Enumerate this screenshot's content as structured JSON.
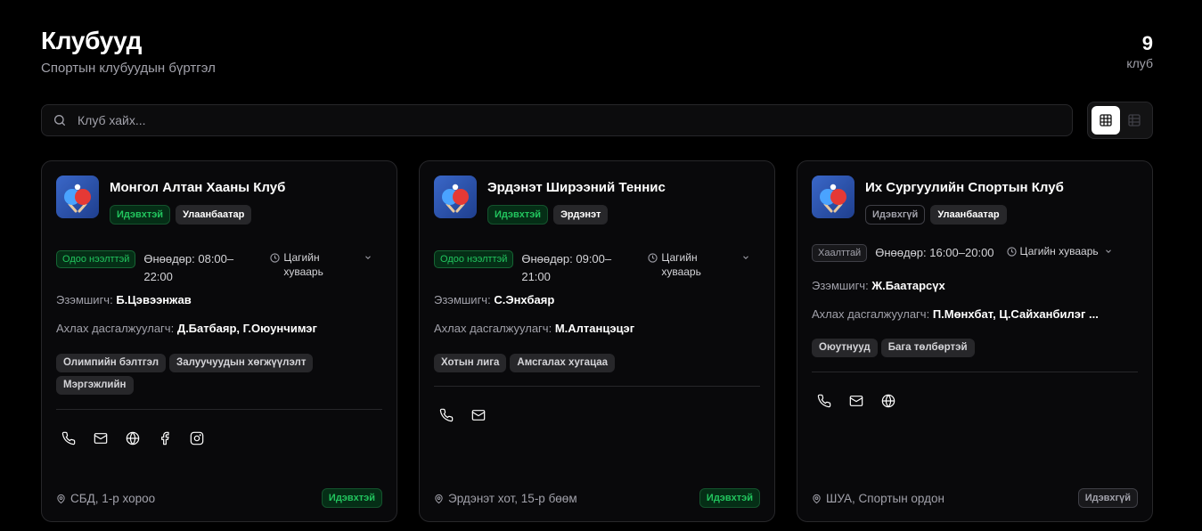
{
  "header": {
    "title": "Клубууд",
    "subtitle": "Спортын клубуудын бүртгэл",
    "count": "9",
    "count_label": "клуб"
  },
  "search": {
    "placeholder": "Клуб хайх...",
    "value": ""
  },
  "view_toggle": {
    "active": "grid"
  },
  "colors": {
    "accent_green": "#22c55e",
    "background": "#000000",
    "card": "#09090b",
    "border": "#27272a"
  },
  "clubs": [
    {
      "name": "Монгол Алтан Хааны Клуб",
      "status_badge": "Идэвхтэй",
      "location_badge": "Улаанбаатар",
      "hours_badge": "Одоо нээлттэй",
      "today": "Өнөөдөр: 08:00–22:00",
      "schedule_label": "Цагийн хуваарь",
      "owner_label": "Эзэмшигч:",
      "owner": "Б.Цэвээнжав",
      "coach_label": "Ахлах дасгалжуулагч:",
      "coaches": "Д.Батбаяр, Г.Оюунчимэг",
      "tags": [
        "Олимпийн бэлтгэл",
        "Залуучуудын хөгжүүлэлт",
        "Мэргэжлийн"
      ],
      "address": "СБД, 1-р хороо",
      "status": "Идэвхтэй"
    },
    {
      "name": "Эрдэнэт Ширээний Теннис",
      "status_badge": "Идэвхтэй",
      "location_badge": "Эрдэнэт",
      "hours_badge": "Одоо нээлттэй",
      "today": "Өнөөдөр: 09:00–21:00",
      "schedule_label": "Цагийн хуваарь",
      "owner_label": "Эзэмшигч:",
      "owner": "С.Энхбаяр",
      "coach_label": "Ахлах дасгалжуулагч:",
      "coaches": "М.Алтанцэцэг",
      "tags": [
        "Хотын лига",
        "Амсгалах хугацаа"
      ],
      "address": "Эрдэнэт хот, 15-р бөөм",
      "status": "Идэвхтэй"
    },
    {
      "name": "Их Сургуулийн Спортын Клуб",
      "status_badge": "Идэвхгүй",
      "location_badge": "Улаанбаатар",
      "hours_badge": "Хаалттай",
      "today": "Өнөөдөр: 16:00–20:00",
      "schedule_label": "Цагийн хуваарь",
      "owner_label": "Эзэмшигч:",
      "owner": "Ж.Баатарсүх",
      "coach_label": "Ахлах дасгалжуулагч:",
      "coaches": "П.Мөнхбат, Ц.Сайханбилэг ...",
      "tags": [
        "Оюутнууд",
        "Бага төлбөртэй"
      ],
      "address": "ШУА, Спортын ордон",
      "status": "Идэвхгүй"
    }
  ]
}
